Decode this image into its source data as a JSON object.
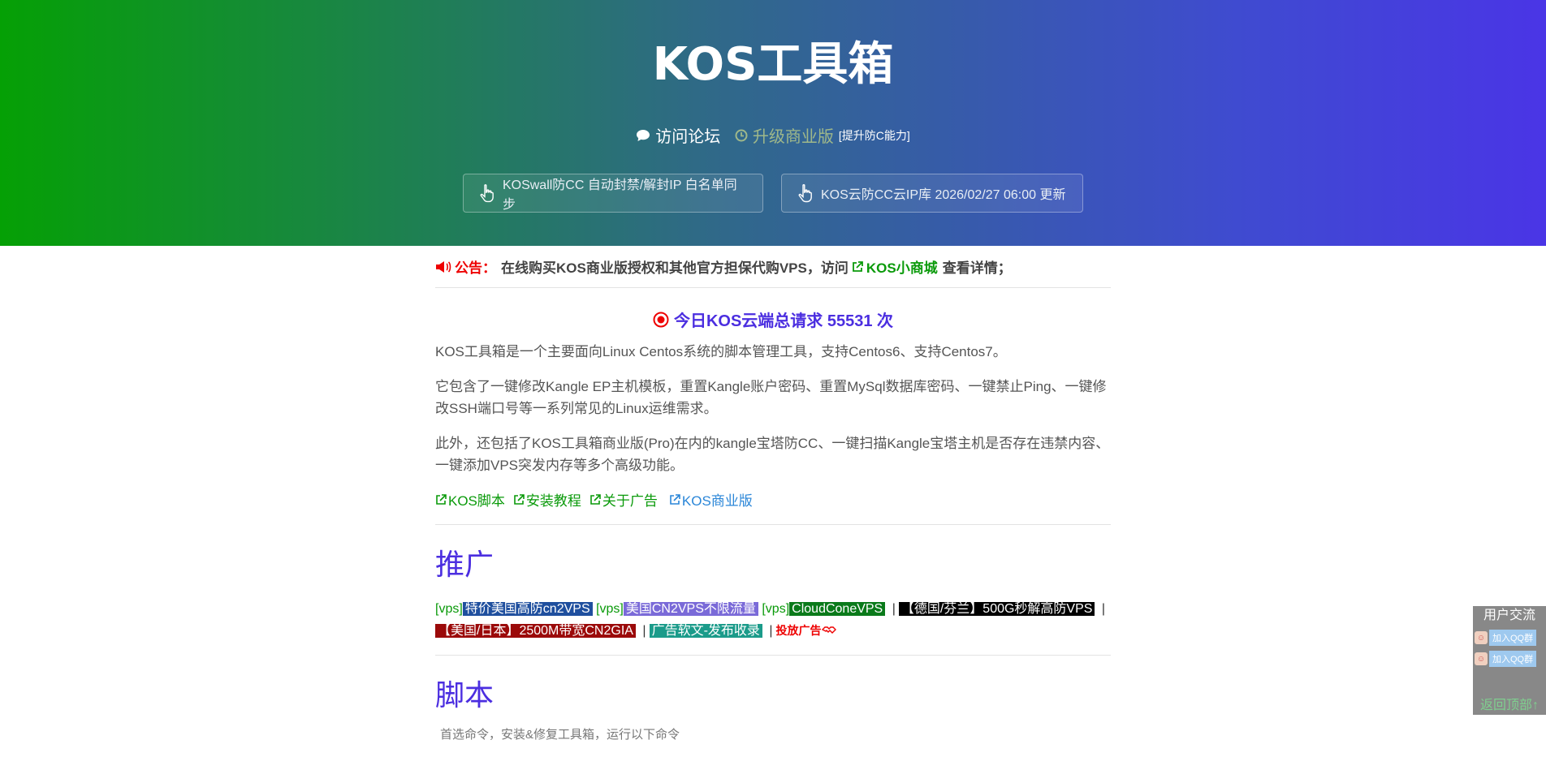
{
  "header": {
    "title": "KOS工具箱",
    "forum_label": "访问论坛",
    "upgrade_label": "升级商业版",
    "upgrade_note": "[提升防C能力]",
    "buttons": [
      {
        "label": "KOSwall防CC 自动封禁/解封IP 白名单同步"
      },
      {
        "label": "KOS云防CC云IP库 2026/02/27 06:00  更新"
      }
    ]
  },
  "notice": {
    "prefix": "公告：",
    "text": "在线购买KOS商业版授权和其他官方担保代购VPS，访问",
    "shop_link": "KOS小商城",
    "suffix": "查看详情；"
  },
  "today": {
    "text": "今日KOS云端总请求 55531 次"
  },
  "intro": {
    "p1": "KOS工具箱是一个主要面向Linux Centos系统的脚本管理工具，支持Centos6、支持Centos7。",
    "p2": "它包含了一键修改Kangle EP主机模板，重置Kangle账户密码、重置MySql数据库密码、一键禁止Ping、一键修改SSH端口号等一系列常见的Linux运维需求。",
    "p3": "此外，还包括了KOS工具箱商业版(Pro)在内的kangle宝塔防CC、一键扫描Kangle宝塔主机是否存在违禁内容、一键添加VPS突发内存等多个高级功能。"
  },
  "links": [
    "KOS脚本",
    "安装教程",
    "关于广告",
    "KOS商业版"
  ],
  "promo": {
    "heading": "推广",
    "vps_prefix": "[vps]",
    "ad1": "特价美国高防cn2VPS",
    "ad2": "美国CN2VPS不限流量",
    "ad3": "CloudConeVPS",
    "ad4": "【德国/芬兰】500G秒解高防VPS",
    "ad5": "【美国/日本】2500M带宽CN2GIA",
    "ad6": "广告软文-发布收录",
    "sep": "|",
    "invite": "投放广告"
  },
  "script": {
    "heading": "脚本",
    "tip": "首选命令，安装&修复工具箱，运行以下命令"
  },
  "float": {
    "title": "用户交流",
    "qq1": "加入QQ群",
    "qq2": "加入QQ群",
    "top": "返回顶部↑"
  },
  "colors": {
    "accent": "#4b2ee0",
    "green": "#0a9a0a",
    "red": "#ee0000"
  }
}
